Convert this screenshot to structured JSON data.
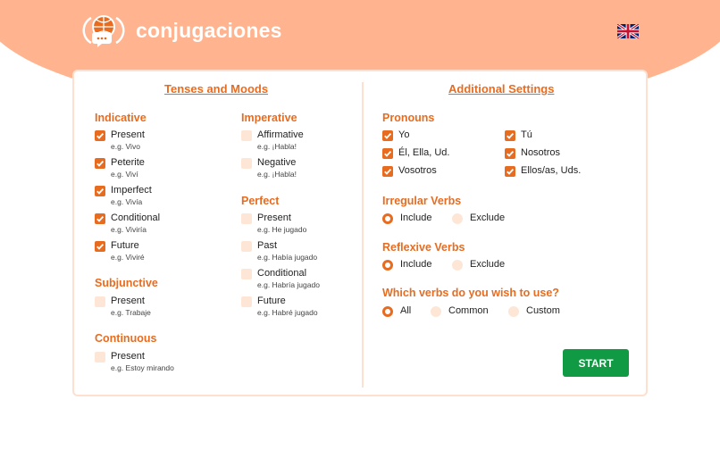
{
  "app": {
    "brand": "conjugaciones",
    "language_flag": "uk-flag-icon"
  },
  "colors": {
    "accent": "#e86c20",
    "hero": "#ffb38e",
    "start": "#109a44",
    "unchecked": "#fde6d6"
  },
  "tenses": {
    "title": "Tenses and Moods",
    "indicative": {
      "title": "Indicative",
      "items": [
        {
          "label": "Present",
          "example": "e.g. Vivo"
        },
        {
          "label": "Peterite",
          "example": "e.g. Viví"
        },
        {
          "label": "Imperfect",
          "example": "e.g. Vivía"
        },
        {
          "label": "Conditional",
          "example": "e.g. Viviría"
        },
        {
          "label": "Future",
          "example": "e.g. Viviré"
        }
      ]
    },
    "imperative": {
      "title": "Imperative",
      "items": [
        {
          "label": "Affirmative",
          "example": "e.g. ¡Habla!"
        },
        {
          "label": "Negative",
          "example": "e.g. ¡Habla!"
        }
      ]
    },
    "perfect": {
      "title": "Perfect",
      "items": [
        {
          "label": "Present",
          "example": "e.g. He jugado"
        },
        {
          "label": "Past",
          "example": "e.g. Había jugado"
        },
        {
          "label": "Conditional",
          "example": "e.g. Habría jugado"
        },
        {
          "label": "Future",
          "example": "e.g. Habré jugado"
        }
      ]
    },
    "subjunctive": {
      "title": "Subjunctive",
      "items": [
        {
          "label": "Present",
          "example": "e.g. Trabaje"
        }
      ]
    },
    "continuous": {
      "title": "Continuous",
      "items": [
        {
          "label": "Present",
          "example": "e.g. Estoy mirando"
        }
      ]
    }
  },
  "settings": {
    "title": "Additional Settings",
    "pronouns": {
      "title": "Pronouns",
      "items": [
        {
          "label": "Yo"
        },
        {
          "label": "Tú"
        },
        {
          "label": "Él, Ella, Ud."
        },
        {
          "label": "Nosotros"
        },
        {
          "label": "Vosotros"
        },
        {
          "label": "Ellos/as, Uds."
        }
      ]
    },
    "irregular": {
      "title": "Irregular Verbs",
      "options": [
        "Include",
        "Exclude"
      ],
      "selected": "Include"
    },
    "reflexive": {
      "title": "Reflexive Verbs",
      "options": [
        "Include",
        "Exclude"
      ],
      "selected": "Include"
    },
    "verbs": {
      "title": "Which verbs do you wish to use?",
      "options": [
        "All",
        "Common",
        "Custom"
      ],
      "selected": "All"
    }
  },
  "start_label": "START"
}
